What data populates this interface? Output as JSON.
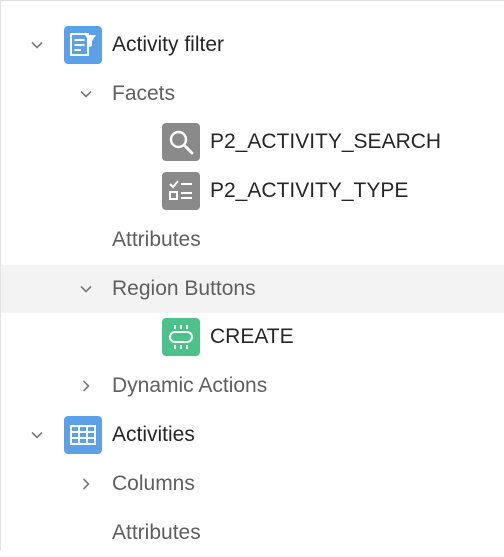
{
  "tree": {
    "activity_filter": {
      "label": "Activity filter",
      "icon": "faceted-search-region-icon",
      "expanded": true
    },
    "facets": {
      "label": "Facets",
      "expanded": true
    },
    "facet_items": [
      {
        "label": "P2_ACTIVITY_SEARCH",
        "icon": "search-icon"
      },
      {
        "label": "P2_ACTIVITY_TYPE",
        "icon": "checkbox-list-icon"
      }
    ],
    "filter_attributes": {
      "label": "Attributes"
    },
    "region_buttons": {
      "label": "Region Buttons",
      "expanded": true
    },
    "create_button": {
      "label": "CREATE",
      "icon": "button-icon"
    },
    "dynamic_actions": {
      "label": "Dynamic Actions",
      "expanded": false
    },
    "activities": {
      "label": "Activities",
      "icon": "report-table-icon",
      "expanded": true
    },
    "columns": {
      "label": "Columns",
      "expanded": false
    },
    "activities_attributes": {
      "label": "Attributes"
    }
  },
  "colors": {
    "region_icon_bg": "#5aa1ea",
    "item_icon_bg": "#8a8a8a",
    "button_icon_bg": "#4cc28a",
    "selected_row_bg": "#f3f3f3"
  }
}
